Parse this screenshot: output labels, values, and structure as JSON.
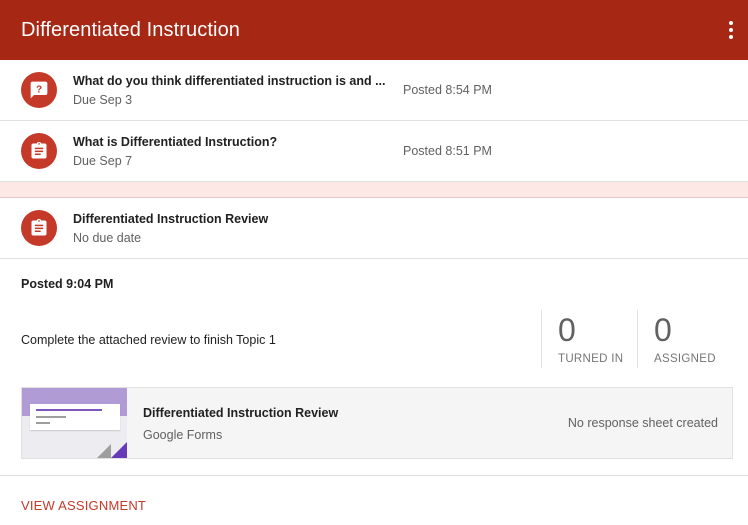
{
  "header": {
    "title": "Differentiated Instruction"
  },
  "items": [
    {
      "icon": "question-icon",
      "title": "What do you think differentiated instruction is and ...",
      "due": "Due Sep 3",
      "posted": "Posted 8:54 PM"
    },
    {
      "icon": "assignment-icon",
      "title": "What is Differentiated Instruction?",
      "due": "Due Sep 7",
      "posted": "Posted 8:51 PM"
    },
    {
      "icon": "assignment-icon",
      "title": "Differentiated Instruction Review",
      "due": "No due date",
      "posted": ""
    }
  ],
  "detail": {
    "posted": "Posted 9:04 PM",
    "description": "Complete the attached review to finish Topic 1",
    "stats": [
      {
        "value": "0",
        "label": "TURNED IN"
      },
      {
        "value": "0",
        "label": "ASSIGNED"
      }
    ],
    "attachment": {
      "title": "Differentiated Instruction Review",
      "type": "Google Forms",
      "status": "No response sheet created"
    },
    "view_label": "VIEW ASSIGNMENT"
  },
  "colors": {
    "header": "#a52714",
    "accent": "#c53929",
    "band": "#fde8e6"
  }
}
